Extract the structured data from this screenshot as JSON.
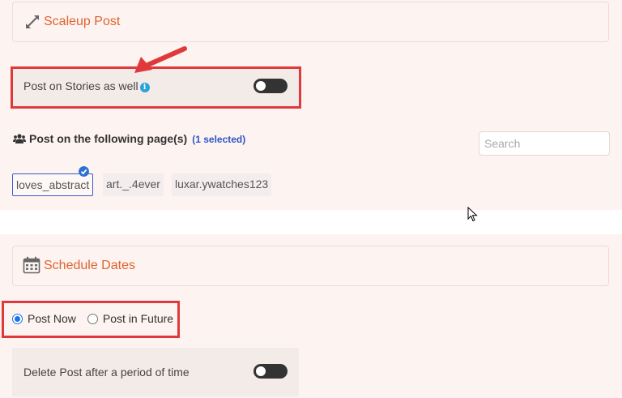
{
  "scaleup": {
    "title": "Scaleup Post",
    "icon": "expand-icon"
  },
  "stories": {
    "label": "Post on Stories as well",
    "info_icon": "info-icon",
    "enabled": false
  },
  "pages": {
    "label": "Post on the following page(s)",
    "selected_count": "(1 selected)",
    "search_placeholder": "Search",
    "items": [
      {
        "name": "loves_abstract",
        "selected": true
      },
      {
        "name": "art._.4ever",
        "selected": false
      },
      {
        "name": "luxar.ywatches123",
        "selected": false
      }
    ]
  },
  "schedule": {
    "title": "Schedule Dates",
    "icon": "calendar-icon",
    "options": [
      {
        "label": "Post Now",
        "checked": true
      },
      {
        "label": "Post in Future",
        "checked": false
      }
    ]
  },
  "delete_post": {
    "label": "Delete Post after a period of time",
    "enabled": false
  },
  "colors": {
    "accent": "#e0632f",
    "link": "#2f55c8",
    "highlight": "#e0393b"
  }
}
